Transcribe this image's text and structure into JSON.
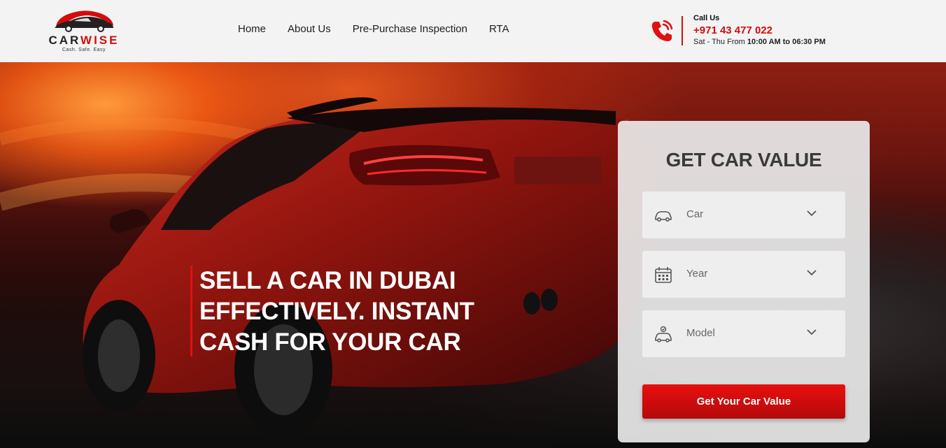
{
  "brand": {
    "name_part1": "CAR",
    "name_part2": "WISE",
    "tagline": "Cash. Safe. Easy",
    "accent_color": "#d40c0c"
  },
  "nav": {
    "items": [
      {
        "label": "Home"
      },
      {
        "label": "About Us"
      },
      {
        "label": "Pre-Purchase Inspection"
      },
      {
        "label": "RTA"
      }
    ]
  },
  "contact": {
    "title": "Call Us",
    "phone": "+971 43 477 022",
    "hours_prefix": "Sat - Thu From ",
    "hours_time": "10:00 AM to 06:30 PM",
    "icon": "phone-icon"
  },
  "hero": {
    "headline": "SELL A CAR IN DUBAI EFFECTIVELY. INSTANT CASH FOR YOUR CAR"
  },
  "form": {
    "title": "GET CAR VALUE",
    "fields": [
      {
        "label": "Car",
        "icon": "car-icon"
      },
      {
        "label": "Year",
        "icon": "calendar-icon"
      },
      {
        "label": "Model",
        "icon": "car-model-icon"
      }
    ],
    "submit_label": "Get Your Car Value"
  }
}
